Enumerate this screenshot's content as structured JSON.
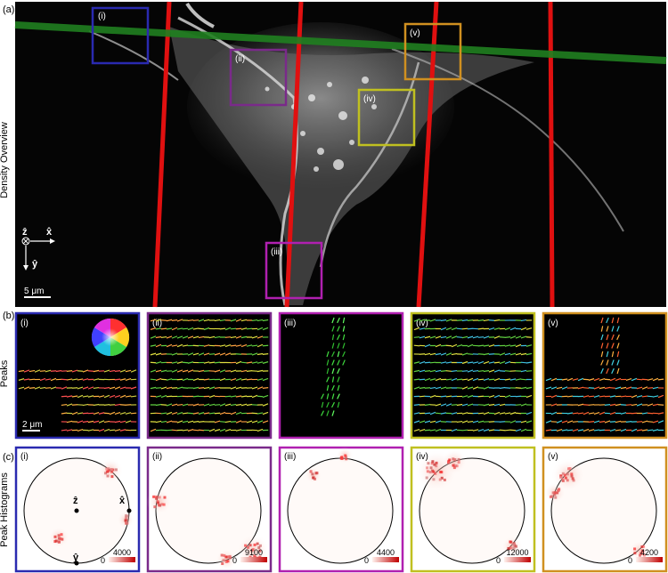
{
  "panel_a": {
    "label": "(a)",
    "row_label": "Density Overview",
    "rois": [
      "(i)",
      "(ii)",
      "(iii)",
      "(iv)",
      "(v)"
    ],
    "axes": {
      "z": "ẑ",
      "x": "x̂",
      "y": "ŷ"
    },
    "scalebar": "5 μm"
  },
  "panel_b": {
    "label": "(b)",
    "row_label": "Peaks",
    "subpanels": [
      "(i)",
      "(ii)",
      "(iii)",
      "(iv)",
      "(v)"
    ],
    "scalebar": "2 μm"
  },
  "panel_c": {
    "label": "(c)",
    "row_label": "Peak Histograms",
    "subpanels": [
      {
        "label": "(i)",
        "min": "0",
        "max": "4000"
      },
      {
        "label": "(ii)",
        "min": "0",
        "max": "9100"
      },
      {
        "label": "(iii)",
        "min": "0",
        "max": "4400"
      },
      {
        "label": "(iv)",
        "min": "0",
        "max": "12000"
      },
      {
        "label": "(v)",
        "min": "0",
        "max": "4200"
      }
    ],
    "axes": {
      "z": "ẑ",
      "x": "x̂",
      "y": "ŷ"
    }
  },
  "colors": {
    "roi_i": "#2a2ab0",
    "roi_ii": "#7a2a8a",
    "roi_iii": "#b020b0",
    "roi_iv": "#c0c020",
    "roi_v": "#d09020",
    "red_line": "#e01010",
    "green_line": "#208020"
  }
}
